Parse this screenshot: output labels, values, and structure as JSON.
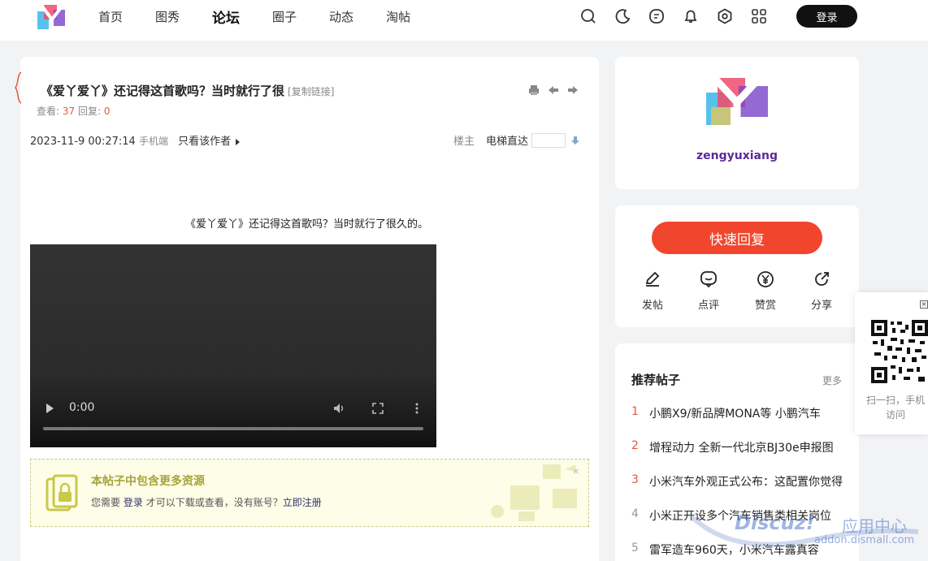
{
  "header": {
    "nav": [
      "首页",
      "图秀",
      "论坛",
      "圈子",
      "动态",
      "淘帖"
    ],
    "active_nav": 2,
    "login_label": "登录",
    "tool_icons": [
      "search-icon",
      "moon-icon",
      "message-icon",
      "bell-icon",
      "settings-icon",
      "grid-icon"
    ]
  },
  "post": {
    "title": "《爱丫爱丫》还记得这首歌吗？当时就行了很",
    "copy_link": "[复制链接]",
    "views_label": "查看:",
    "views": "37",
    "replies_label": "回复:",
    "replies": "0",
    "datetime": "2023-11-9 00:27:14",
    "device": "手机端",
    "only_author": "只看该作者",
    "floor_label": "楼主",
    "jump_label": "电梯直达",
    "content": "《爱丫爱丫》还记得这首歌吗？当时就行了很久的。",
    "video_time": "0:00",
    "resource": {
      "title": "本帖子中包含更多资源",
      "desc_prefix": "您需要",
      "login_link": "登录",
      "desc_mid": "才可以下载或查看，没有账号？",
      "register_link": "立即注册",
      "close": "×"
    }
  },
  "sidebar": {
    "username": "zengyuxiang",
    "reply_button": "快速回复",
    "actions": [
      "发帖",
      "点评",
      "赞赏",
      "分享"
    ],
    "recommend_title": "推荐帖子",
    "recommend_more": "更多",
    "recommend": [
      "小鹏X9/新品牌MONA等 小鹏汽车",
      "增程动力 全新一代北京BJ30e申报图",
      "小米汽车外观正式公布：这配置你觉得",
      "小米正开设多个汽车销售类相关岗位",
      "雷军造车960天，小米汽车露真容"
    ]
  },
  "qr": {
    "close": "×",
    "text": "扫一扫，手机访问"
  },
  "watermark": {
    "brand": "Discuz!",
    "cn": "应用中心",
    "url": "addon.dismall.com"
  },
  "colors": {
    "accent": "#f2452d",
    "highlight": "#e5573d",
    "username": "#5b2a96"
  }
}
